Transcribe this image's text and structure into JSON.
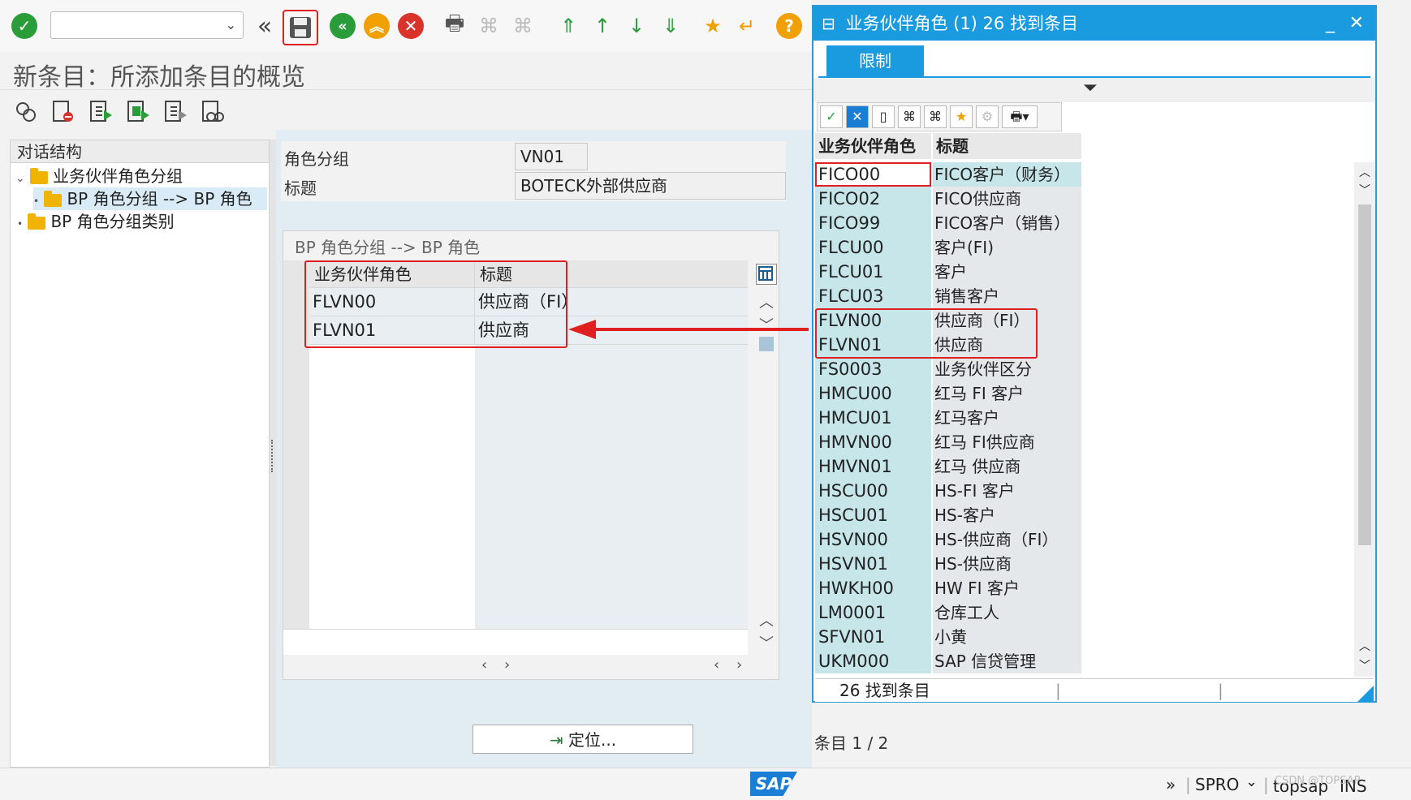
{
  "command_field": {
    "value": ""
  },
  "page_title": "新条目：所添加条目的概览",
  "tree": {
    "header": "对话结构",
    "items": [
      {
        "label": "业务伙伴角色分组"
      },
      {
        "label": "BP 角色分组 --> BP 角色"
      },
      {
        "label": "BP 角色分组类别"
      }
    ]
  },
  "fields": {
    "role_group_label": "角色分组",
    "role_group_value": "VN01",
    "title_label": "标题",
    "title_value": "BOTECK外部供应商"
  },
  "table_control": {
    "title": "BP 角色分组 --> BP 角色",
    "col1": "业务伙伴角色",
    "col2": "标题",
    "rows": [
      {
        "role": "FLVN00",
        "title": "供应商（FI）"
      },
      {
        "role": "FLVN01",
        "title": "供应商"
      }
    ]
  },
  "locate_button": "定位...",
  "entry_count": "条目 1 / 2",
  "popup": {
    "title": "业务伙伴角色 (1)   26 找到条目",
    "tab": "限制",
    "col1": "业务伙伴角色",
    "col2": "标题",
    "rows": [
      {
        "role": "FICO00",
        "title": "FICO客户（财务）"
      },
      {
        "role": "FICO02",
        "title": "FICO供应商"
      },
      {
        "role": "FICO99",
        "title": "FICO客户（销售）"
      },
      {
        "role": "FLCU00",
        "title": "客户(FI)"
      },
      {
        "role": "FLCU01",
        "title": "客户"
      },
      {
        "role": "FLCU03",
        "title": "销售客户"
      },
      {
        "role": "FLVN00",
        "title": "供应商（FI）"
      },
      {
        "role": "FLVN01",
        "title": "供应商"
      },
      {
        "role": "FS0003",
        "title": "业务伙伴区分"
      },
      {
        "role": "HMCU00",
        "title": "红马 FI 客户"
      },
      {
        "role": "HMCU01",
        "title": "红马客户"
      },
      {
        "role": "HMVN00",
        "title": "红马 FI供应商"
      },
      {
        "role": "HMVN01",
        "title": "红马 供应商"
      },
      {
        "role": "HSCU00",
        "title": "HS-FI 客户"
      },
      {
        "role": "HSCU01",
        "title": "HS-客户"
      },
      {
        "role": "HSVN00",
        "title": "HS-供应商（FI）"
      },
      {
        "role": "HSVN01",
        "title": "HS-供应商"
      },
      {
        "role": "HWKH00",
        "title": "HW FI 客户"
      },
      {
        "role": "LM0001",
        "title": "仓库工人"
      },
      {
        "role": "SFVN01",
        "title": "小黄"
      },
      {
        "role": "UKM000",
        "title": "SAP 信贷管理"
      }
    ],
    "status": "26 找到条目"
  },
  "statusbar": {
    "transaction": "SPRO",
    "system": "topsap",
    "mode": "INS",
    "watermark": "CSDN @TOPSAP"
  },
  "icons": {
    "enter": "check-icon",
    "save": "save-icon",
    "back": "back-icon",
    "exit": "exit-icon",
    "cancel": "cancel-icon",
    "help": "help-icon"
  },
  "colors": {
    "popup_accent": "#1a9be0",
    "highlight_red": "#e02020",
    "green": "#2a9d3a",
    "orange": "#f0a000",
    "red": "#d9342b"
  }
}
